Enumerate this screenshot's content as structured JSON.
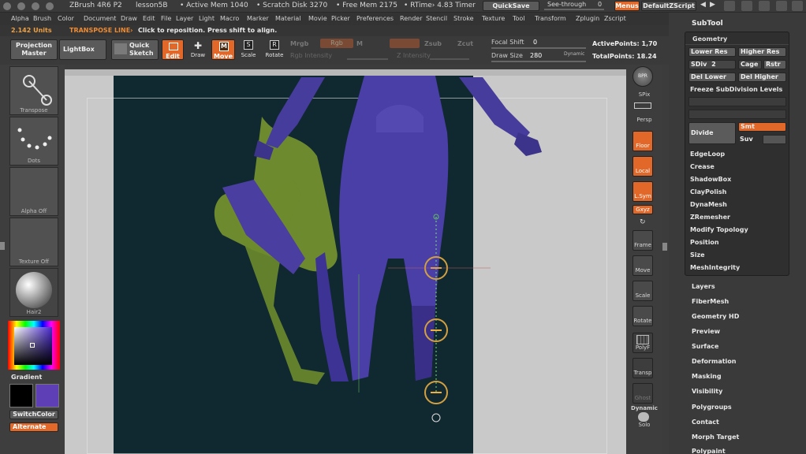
{
  "titlebar": {
    "app": "ZBrush 4R6 P2",
    "doc": "lesson5B",
    "active_mem": "• Active Mem 1040",
    "scratch_disk": "• Scratch Disk 3270",
    "free_mem": "• Free Mem 2175",
    "rtime": "• RTime› 4.83 Timer",
    "quicksave": "QuickSave",
    "see_through": "See-through",
    "see_through_value": "0",
    "menus": "Menus",
    "script": "DefaultZScript"
  },
  "menubar": [
    "Alpha",
    "Brush",
    "Color",
    "Document",
    "Draw",
    "Edit",
    "File",
    "Layer",
    "Light",
    "Macro",
    "Marker",
    "Material",
    "Movie",
    "Picker",
    "Preferences",
    "Render",
    "Stencil",
    "Stroke",
    "Texture",
    "Tool",
    "Transform",
    "Zplugin",
    "Zscript"
  ],
  "status": {
    "units": "2.142 Units",
    "mode": "TRANSPOSE LINE›",
    "hint": "Click to reposition. Press shift to align."
  },
  "shelf": {
    "projection": "Projection Master",
    "lightbox": "LightBox",
    "quick_sketch": "Quick Sketch",
    "edit": "Edit",
    "draw": "Draw",
    "move": "Move",
    "scale": "Scale",
    "rotate": "Rotate",
    "mrgb": "Mrgb",
    "rgb": "Rgb",
    "m": "M",
    "zadd": "Zadd",
    "zsub": "Zsub",
    "zcut": "Zcut",
    "rgb_intensity": "Rgb Intensity",
    "z_intensity": "Z Intensity",
    "focal_shift": "Focal Shift",
    "focal_shift_value": "0",
    "draw_size": "Draw Size",
    "draw_size_value": "280",
    "dynamic": "Dynamic",
    "active_points": "ActivePoints: 1,70",
    "total_points": "TotalPoints: 18.24"
  },
  "leftshelf": {
    "transpose": "Transpose",
    "dots": "Dots",
    "alpha": "Alpha Off",
    "texture": "Texture Off",
    "material": "Hair2",
    "gradient": "Gradient",
    "switch_color": "SwitchColor",
    "alternate": "Alternate",
    "colors": {
      "primary": "#000000",
      "secondary": "#5f3fb5"
    }
  },
  "rightshelf": {
    "bpr": "BPR",
    "spix": "SPix",
    "persp": "Persp",
    "floor": "Floor",
    "local": "Local",
    "lsym": "L.Sym",
    "xyz": "Gxyz",
    "frame": "Frame",
    "move": "Move",
    "scale": "Scale",
    "rotate": "Rotate",
    "polyf": "PolyF",
    "transp": "Transp",
    "ghost": "Ghost",
    "dynamic": "Dynamic",
    "solo": "Solo"
  },
  "tray": {
    "subtool": "SubTool",
    "geometry": "Geometry",
    "lower_res": "Lower Res",
    "higher_res": "Higher Res",
    "sdiv": "SDiv",
    "sdiv_value": "2",
    "cage": "Cage",
    "rstr": "Rstr",
    "del_lower": "Del Lower",
    "del_higher": "Del Higher",
    "freeze": "Freeze SubDivision Levels",
    "divide": "Divide",
    "smt": "Smt",
    "suv": "Suv",
    "items": [
      "EdgeLoop",
      "Crease",
      "ShadowBox",
      "ClayPolish",
      "DynaMesh",
      "ZRemesher",
      "Modify Topology",
      "Position",
      "Size",
      "MeshIntegrity"
    ],
    "sections": [
      "Layers",
      "FiberMesh",
      "Geometry HD",
      "Preview",
      "Surface",
      "Deformation",
      "Masking",
      "Visibility",
      "Polygroups",
      "Contact",
      "Morph Target",
      "Polypaint"
    ]
  },
  "accent": "#e2682a"
}
